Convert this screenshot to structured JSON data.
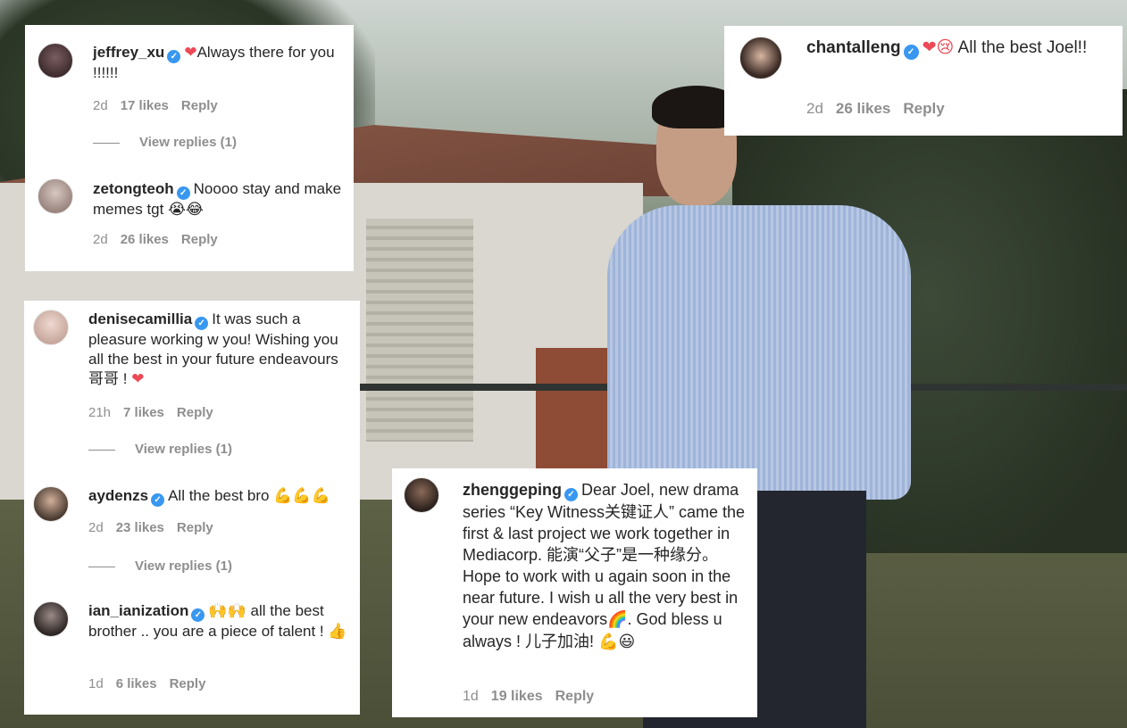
{
  "comments": {
    "jeffrey": {
      "username": "jeffrey_xu",
      "emoji": "❤",
      "text": "Always there for you !!!!!!",
      "time": "2d",
      "likes": "17 likes",
      "reply": "Reply",
      "view_replies": "View replies (1)"
    },
    "zetong": {
      "username": "zetongteoh",
      "text": "Noooo stay and make memes tgt",
      "emoji": "😭😂",
      "time": "2d",
      "likes": "26 likes",
      "reply": "Reply"
    },
    "chantal": {
      "username": "chantalleng",
      "emoji": "❤😢",
      "text": "All the best Joel!!",
      "time": "2d",
      "likes": "26 likes",
      "reply": "Reply"
    },
    "denise": {
      "username": "denisecamillia",
      "text": "It was such a pleasure working w you! Wishing you all the best in your future endeavours 哥哥 !",
      "emoji": "❤",
      "time": "21h",
      "likes": "7 likes",
      "reply": "Reply",
      "view_replies": "View replies (1)"
    },
    "ayden": {
      "username": "aydenzs",
      "text": "All the best bro",
      "emoji": "💪💪💪",
      "time": "2d",
      "likes": "23 likes",
      "reply": "Reply",
      "view_replies": "View replies (1)"
    },
    "ian": {
      "username": "ian_ianization",
      "emoji": "🙌🙌",
      "text": "all the best brother .. you are a piece of talent !",
      "emoji2": "👍",
      "time": "1d",
      "likes": "6 likes",
      "reply": "Reply"
    },
    "zheng": {
      "username": "zhenggeping",
      "text": "Dear Joel, new drama series “Key Witness关键证人” came the first & last project we work together in Mediacorp. 能演“父子”是一种缘分。Hope to work with u again soon in the near future. I wish u all the very best in your new endeavors",
      "emoji": "🌈",
      "text2": ". God bless u always ! 儿子加油!",
      "emoji2": "💪😃",
      "time": "1d",
      "likes": "19 likes",
      "reply": "Reply"
    }
  },
  "colors": {
    "verified": "#3897f0",
    "meta": "#8e8e8e",
    "text": "#262626",
    "heart": "#ed4956"
  },
  "icons": {
    "verified": "verified-badge-icon"
  }
}
